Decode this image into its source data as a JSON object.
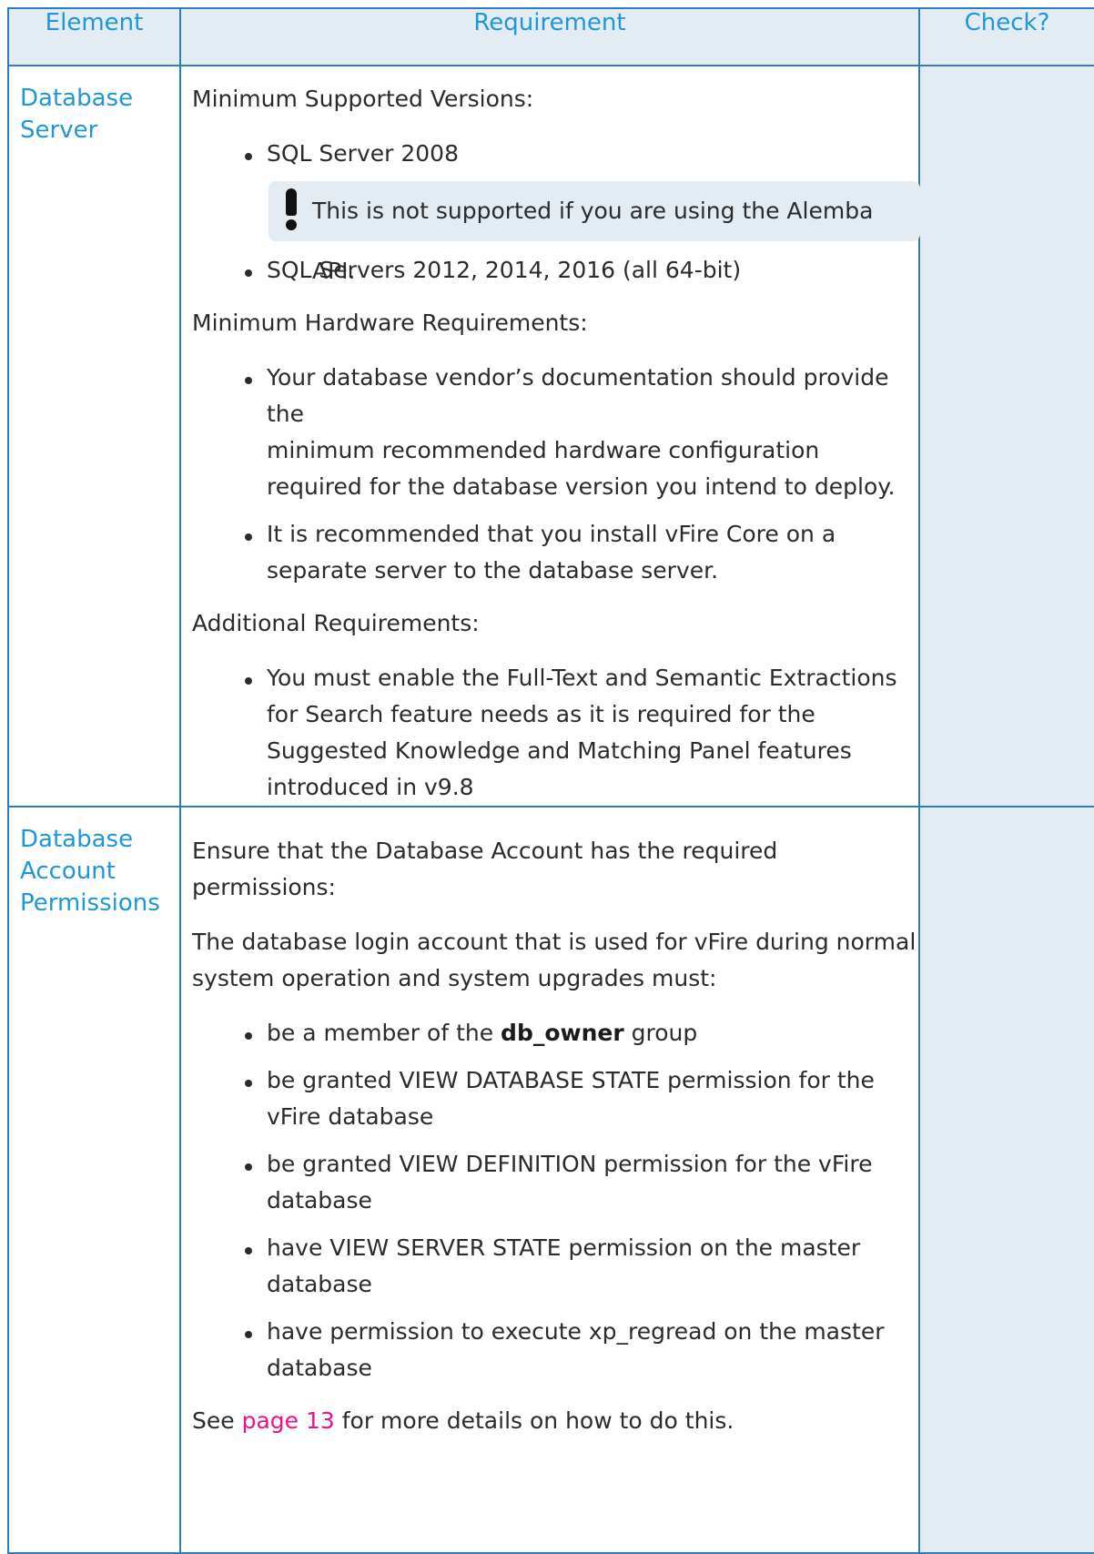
{
  "headers": {
    "element": "Element",
    "requirement": "Requirement",
    "check": "Check?"
  },
  "rows": [
    {
      "element": [
        "Database",
        "Server"
      ],
      "sections": [
        {
          "heading": "Minimum Supported Versions:",
          "items": [
            "SQL Server 2008",
            "SQL Servers 2012, 2014, 2016 (all 64-bit)"
          ],
          "note": {
            "icon": "exclamation-icon",
            "text": "This is not supported if you are using the Alemba API."
          }
        },
        {
          "heading": "Minimum Hardware Requirements:",
          "items": [
            [
              "Your database vendor’s documentation should provide the",
              "minimum recommended hardware configuration",
              "required for the database version you intend to deploy."
            ],
            [
              "It is recommended that you install vFire Core on a",
              "separate server to the database server."
            ]
          ]
        },
        {
          "heading": "Additional Requirements:",
          "items": [
            [
              "You must enable the Full-Text and Semantic Extractions",
              "for Search feature needs as it is required for the",
              "Suggested Knowledge and Matching Panel features",
              "introduced in v9.8"
            ]
          ]
        }
      ]
    },
    {
      "element": [
        "Database",
        "Account",
        "Permissions"
      ],
      "intro": "Ensure that the Database Account has the required permissions:",
      "para": [
        "The database login account that is used for vFire during normal",
        "system operation and system upgrades must:"
      ],
      "items": [
        {
          "before": "be a member of the ",
          "bold": "db_owner",
          "after": " group"
        },
        [
          "be granted VIEW DATABASE STATE permission for the",
          "vFire database"
        ],
        [
          "be granted VIEW DEFINITION permission for the vFire",
          "database"
        ],
        [
          "have VIEW SERVER STATE permission on the master",
          "database"
        ],
        [
          "have permission to execute xp_regread on the master",
          "database"
        ]
      ],
      "see": {
        "before": "See ",
        "link": "page 13",
        "after": " for more details on how to do this."
      }
    }
  ]
}
